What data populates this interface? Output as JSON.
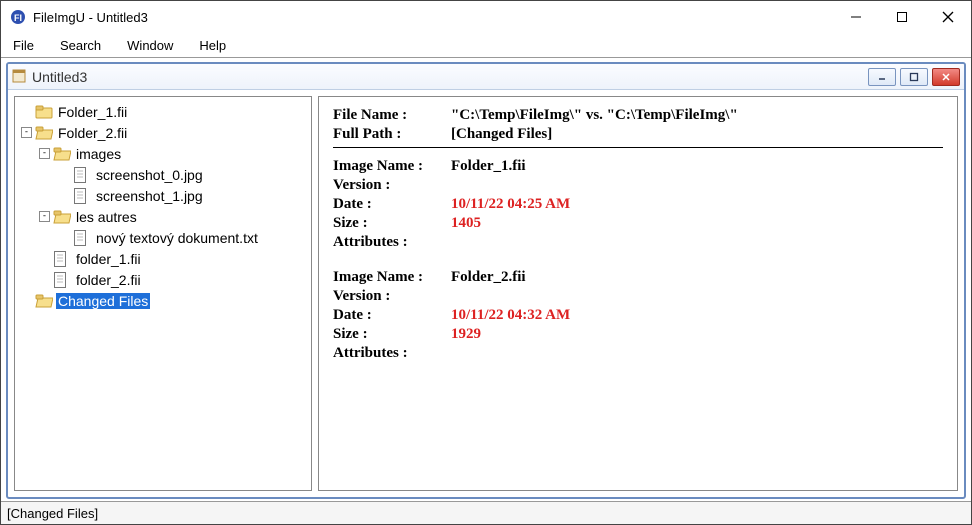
{
  "app": {
    "title": "FileImgU - Untitled3",
    "menu": [
      "File",
      "Search",
      "Window",
      "Help"
    ]
  },
  "child": {
    "title": "Untitled3"
  },
  "tree": {
    "items": [
      {
        "level": 0,
        "exp": "",
        "icon": "folder",
        "label": "Folder_1.fii",
        "selected": false
      },
      {
        "level": 0,
        "exp": "-",
        "icon": "folder-open",
        "label": "Folder_2.fii",
        "selected": false
      },
      {
        "level": 1,
        "exp": "-",
        "icon": "folder-open",
        "label": "images",
        "selected": false
      },
      {
        "level": 2,
        "exp": "",
        "icon": "file",
        "label": "screenshot_0.jpg",
        "selected": false
      },
      {
        "level": 2,
        "exp": "",
        "icon": "file",
        "label": "screenshot_1.jpg",
        "selected": false
      },
      {
        "level": 1,
        "exp": "-",
        "icon": "folder-open",
        "label": "les autres",
        "selected": false
      },
      {
        "level": 2,
        "exp": "",
        "icon": "file",
        "label": "nový textový dokument.txt",
        "selected": false
      },
      {
        "level": 1,
        "exp": "",
        "icon": "file",
        "label": "folder_1.fii",
        "selected": false
      },
      {
        "level": 1,
        "exp": "",
        "icon": "file",
        "label": "folder_2.fii",
        "selected": false
      },
      {
        "level": 0,
        "exp": "",
        "icon": "folder-open",
        "label": "Changed Files",
        "selected": true
      }
    ]
  },
  "details": {
    "header": {
      "file_name_label": "File Name :",
      "file_name_value": "\"C:\\Temp\\FileImg\\\" vs. \"C:\\Temp\\FileImg\\\"",
      "full_path_label": "Full Path :",
      "full_path_value": "[Changed Files]"
    },
    "labels": {
      "image_name": "Image Name :",
      "version": "Version :",
      "date": "Date :",
      "size": "Size :",
      "attributes": "Attributes :"
    },
    "images": [
      {
        "name": "Folder_1.fii",
        "version": "",
        "date": "10/11/22 04:25 AM",
        "size": "1405",
        "attributes": ""
      },
      {
        "name": "Folder_2.fii",
        "version": "",
        "date": "10/11/22 04:32 AM",
        "size": "1929",
        "attributes": ""
      }
    ]
  },
  "status": "[Changed Files]"
}
